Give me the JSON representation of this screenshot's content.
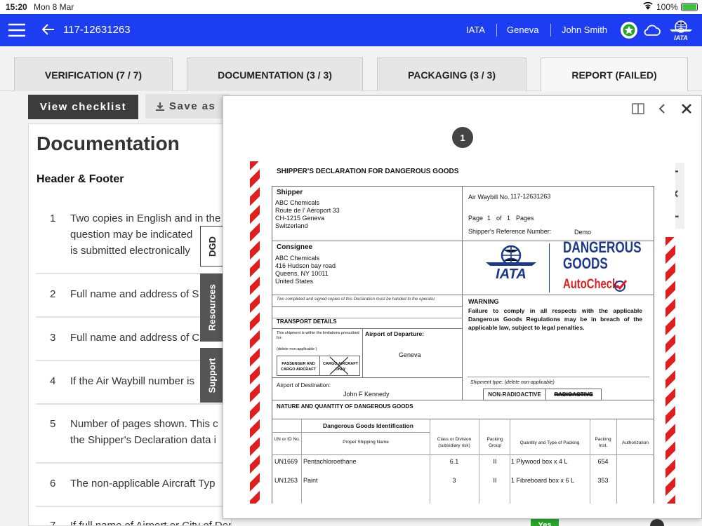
{
  "status_bar": {
    "time": "15:20",
    "date": "Mon 8 Mar",
    "battery": "100%"
  },
  "app_bar": {
    "back_title": "117-12631263",
    "org": "IATA",
    "station": "Geneva",
    "user": "John Smith",
    "brand_color": "#1d3df2"
  },
  "tabs": [
    {
      "label": "VERIFICATION (7 / 7)"
    },
    {
      "label": "DOCUMENTATION (3 / 3)"
    },
    {
      "label": "PACKAGING (3 / 3)"
    },
    {
      "label": "REPORT (FAILED)"
    }
  ],
  "toolbar": {
    "view_checklist": "View checklist",
    "save_as": "Save as"
  },
  "checklist": {
    "title": "Documentation",
    "section": "Header & Footer",
    "items": [
      {
        "num": "1",
        "lines": [
          "Two copies in English and in the",
          "question may be indicated",
          "is submitted electronically"
        ]
      },
      {
        "num": "2",
        "lines": [
          "Full name and address of S"
        ]
      },
      {
        "num": "3",
        "lines": [
          "Full name and address of C"
        ]
      },
      {
        "num": "4",
        "lines": [
          "If the Air Waybill number is"
        ]
      },
      {
        "num": "5",
        "lines": [
          "Number of pages shown. This c",
          "the Shipper's Declaration data i"
        ]
      },
      {
        "num": "6",
        "lines": [
          "The non-applicable Aircraft Typ"
        ]
      },
      {
        "num": "7",
        "lines": [
          "If full name of Airport or City of Departure is not shown, enter it"
        ]
      }
    ],
    "answer_badge": "Yes"
  },
  "side_tabs": {
    "dgd": "DGD",
    "resources": "Resources",
    "support": "Support"
  },
  "viewer": {
    "page_badge": "1",
    "zoom_in": "+",
    "zoom_reset": "×",
    "zoom_out": "−"
  },
  "declaration": {
    "title": "SHIPPER'S DECLARATION FOR DANGEROUS GOODS",
    "shipper_label": "Shipper",
    "shipper_lines": [
      "ABC Chemicals",
      "Route de l' Aéroport 33",
      "CH-1215 Geneva",
      "Switzerland"
    ],
    "awb_label": "Air Waybill No.",
    "awb_value": "117-12631263",
    "page_label": "Page",
    "page_no": "1",
    "of_label": "of",
    "page_total": "1",
    "pages_label": "Pages",
    "ref_label": "Shipper's Reference Number:",
    "ref_value": "Demo",
    "consignee_label": "Consignee",
    "consignee_lines": [
      "ABC Chemicals",
      "416 Hudson bay road",
      "Queens, NY 10011",
      "United States"
    ],
    "iata_logo": "IATA",
    "dg_logo_1": "DANGEROUS",
    "dg_logo_2": "GOODS",
    "dg_logo_3": "AutoCheck",
    "copies_note": "Two completed and signed copies of this Declaration must be handed to the operator.",
    "warning_title": "WARNING",
    "warning_text": "Failure to comply in all respects with the applicable Dangerous Goods Regulations may be in breach of the applicable law, subject to legal penalties.",
    "transport_label": "TRANSPORT DETAILS",
    "limit_note": "This shipment is within the limitations prescribed for:",
    "delete_note": "(delete non-applicable )",
    "pax_cargo": "PASSENGER AND CARGO AIRCRAFT",
    "cargo_only": "CARGO AIRCRAFT ONLY",
    "departure_label": "Airport of Departure:",
    "departure_value": "Geneva",
    "destination_label": "Airport of Destination:",
    "destination_value": "John F Kennedy",
    "shipment_type_label": "Shipment type: (delete non-applicable)",
    "non_radioactive": "NON-RADIOACTIVE",
    "radioactive": "RADIOACTIVE",
    "nature_label": "NATURE AND QUANTITY OF DANGEROUS GOODS",
    "dg_id_label": "Dangerous Goods Identification",
    "columns": [
      "UN or ID No.",
      "Proper Shipping Name",
      "Class or Division (subsidiary risk)",
      "Packing Group",
      "Quantity and Type of Packing",
      "Packing Inst.",
      "Authorization"
    ],
    "rows": [
      {
        "un": "UN1669",
        "name": "Pentachloroethane",
        "cls": "6.1",
        "pg": "II",
        "qty": "1 Plywood box x 4 L",
        "pi": "654"
      },
      {
        "un": "UN1263",
        "name": "Paint",
        "cls": "3",
        "pg": "II",
        "qty": "1 Fibreboard box x 6 L",
        "pi": "353"
      }
    ]
  }
}
